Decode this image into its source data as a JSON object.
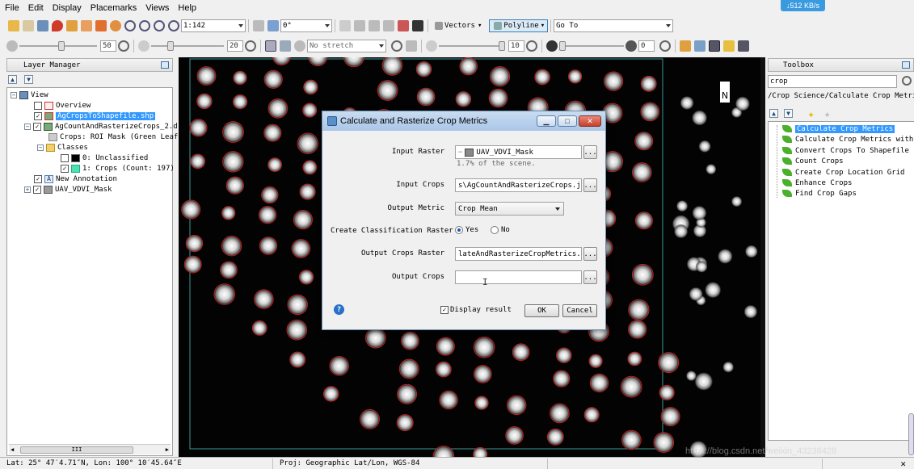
{
  "menu": [
    "File",
    "Edit",
    "Display",
    "Placemarks",
    "Views",
    "Help"
  ],
  "netspeed": "↓512 KB/s",
  "toolbar": {
    "zoom": "1:142",
    "rotation": "0°",
    "vectors_label": "Vectors",
    "polyline_label": "Polyline",
    "goto_label": "Go To",
    "brightness": "50",
    "contrast": "20",
    "stretch": "No stretch",
    "sharpen": "10",
    "transparency": "0"
  },
  "layer_manager": {
    "title": "Layer Manager",
    "items": [
      {
        "label": "View"
      },
      {
        "label": "Overview"
      },
      {
        "label": "AgCropsToShapefile.shp"
      },
      {
        "label": "AgCountAndRasterizeCrops_2.d"
      },
      {
        "label": "Crops: ROI Mask (Green Leaf"
      },
      {
        "label": "Classes"
      },
      {
        "label": "0: Unclassified"
      },
      {
        "label": "1: Crops (Count: 197)"
      },
      {
        "label": "New Annotation"
      },
      {
        "label": "UAV_VDVI_Mask"
      }
    ],
    "scroll_grip": "III"
  },
  "toolbox": {
    "title": "Toolbox",
    "search_value": "crop",
    "path": "/Crop Science/Calculate Crop Metrics",
    "items": [
      "Calculate Crop Metrics",
      "Calculate Crop Metrics with Sp",
      "Convert Crops To Shapefile",
      "Count Crops",
      "Create Crop Location Grid",
      "Enhance Crops",
      "Find Crop Gaps"
    ]
  },
  "dialog": {
    "title": "Calculate and Rasterize Crop Metrics",
    "input_raster_label": "Input Raster",
    "input_raster_value": "UAV_VDVI_Mask",
    "input_raster_note": "1.7% of the scene.",
    "input_crops_label": "Input Crops",
    "input_crops_value": "s\\AgCountAndRasterizeCrops.json",
    "output_metric_label": "Output Metric",
    "output_metric_value": "Crop Mean",
    "classification_label": "Create Classification Raster",
    "yes_label": "Yes",
    "no_label": "No",
    "output_raster_label": "Output Crops Raster",
    "output_raster_value": "lateAndRasterizeCropMetrics.dat",
    "output_crops_label": "Output Crops",
    "output_crops_value": "",
    "browse_label": "...",
    "display_result_label": "Display result",
    "ok_label": "OK",
    "cancel_label": "Cancel",
    "help_label": "?"
  },
  "statusbar": {
    "coords": "Lat: 25° 47′4.71″N, Lon: 100° 10′45.64″E",
    "projection": "Proj: Geographic Lat/Lon, WGS-84"
  },
  "watermark": "https://blog.csdn.net/weixin_43238428",
  "colors": {
    "selection": "#3399ff",
    "crop_outline": "#c42020",
    "title_bar": "#a9c6e8",
    "leaf_icon": "#4caf2e"
  }
}
